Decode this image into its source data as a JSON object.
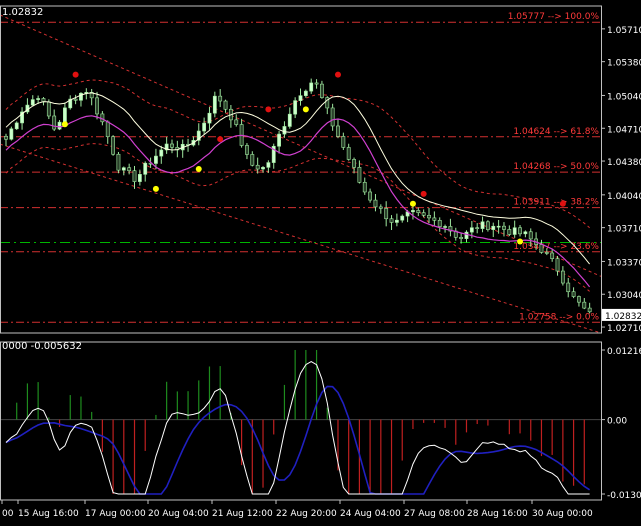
{
  "header": {
    "price_label": "1.02832"
  },
  "colors": {
    "background": "#000000",
    "frame": "#c0c0c0",
    "candle_up": "#ccffcc",
    "candle_down": "#2a402a",
    "candle_wick": "#9fe89f",
    "fib_line": "#d23030",
    "fib_label": "#ff3a3a",
    "env_outer": "#d23030",
    "white_ma": "#ffffe0",
    "magenta_ma": "#d040d0",
    "current_price_line": "#00b400",
    "fractal_up": "#e01010",
    "fractal_down": "#ffff00",
    "hist_up": "#1e8c1e",
    "hist_down": "#c02020",
    "osc_line": "#ffffff",
    "signal_line": "#2020c0",
    "axis_text": "#ffffff",
    "price_box_bg": "#ffffff",
    "price_box_text": "#000000"
  },
  "price_axis": {
    "labels": [
      "1.05710",
      "1.05380",
      "1.05040",
      "1.04710",
      "1.04380",
      "1.04040",
      "1.03710",
      "1.03370",
      "1.03040",
      "1.02710"
    ],
    "current_price": "1.02832"
  },
  "fib_levels": [
    {
      "label": "1.05777 --> 100.0%",
      "price": 1.05777
    },
    {
      "label": "1.04624 --> 61.8%",
      "price": 1.04624
    },
    {
      "label": "1.04268 --> 50.0%",
      "price": 1.04268
    },
    {
      "label": "1.03911 --> 38.2%",
      "price": 1.03911
    },
    {
      "label": "1.03467 --> 23.6%",
      "price": 1.03467
    },
    {
      "label": "1.02758 --> 0.0%",
      "price": 1.02758
    }
  ],
  "green_level": {
    "price": 1.0356
  },
  "oscillator": {
    "header": "0000 -0.005632",
    "axis_labels": [
      "0.012168",
      "0.00",
      "-0.013011"
    ]
  },
  "time_axis": {
    "labels": [
      "00",
      "15 Aug 16:00",
      "17 Aug 00:00",
      "20 Aug 04:00",
      "21 Aug 12:00",
      "22 Aug 20:00",
      "24 Aug 04:00",
      "27 Aug 08:00",
      "28 Aug 16:00",
      "30 Aug 00:00"
    ]
  },
  "chart_data": {
    "type": "candlestick",
    "symbol_price": 1.02832,
    "ylim": [
      1.0265,
      1.0594
    ],
    "candles_close_trend": [
      1.046,
      1.049,
      1.0505,
      1.047,
      1.05,
      1.051,
      1.0475,
      1.043,
      1.042,
      1.044,
      1.0455,
      1.045,
      1.047,
      1.0505,
      1.048,
      1.0435,
      1.043,
      1.047,
      1.0505,
      1.052,
      1.048,
      1.0445,
      1.041,
      1.039,
      1.0375,
      1.0385,
      1.038,
      1.0375,
      1.036,
      1.0372,
      1.0374,
      1.0368,
      1.0364,
      1.035,
      1.033,
      1.03,
      1.0283
    ],
    "fractal_up_points": [
      1.0525,
      1.046,
      1.049,
      1.0525,
      1.0405,
      1.0395
    ],
    "fractal_down_points": [
      1.0475,
      1.041,
      1.043,
      1.049,
      1.0395,
      1.0357
    ],
    "oscillator_range": [
      -0.013011,
      0.012168
    ]
  }
}
